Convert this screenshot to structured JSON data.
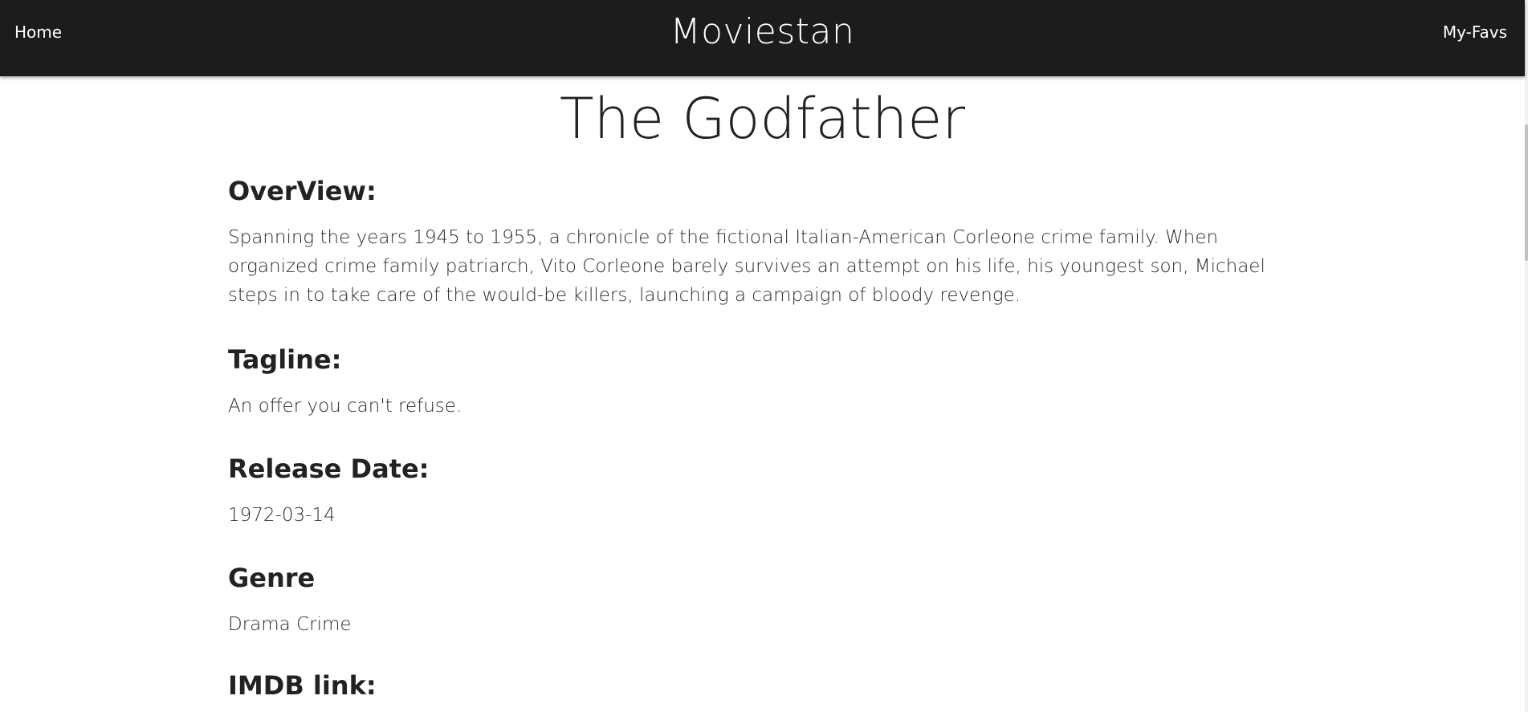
{
  "nav": {
    "home_label": "Home",
    "brand": "Moviestan",
    "favs_label": "My-Favs"
  },
  "movie": {
    "title": "The Godfather",
    "sections": {
      "overview": {
        "heading": "OverView:",
        "text": "Spanning the years 1945 to 1955, a chronicle of the fictional Italian-American Corleone crime family. When organized crime family patriarch, Vito Corleone barely survives an attempt on his life, his youngest son, Michael steps in to take care of the would-be killers, launching a campaign of bloody revenge."
      },
      "tagline": {
        "heading": "Tagline:",
        "text": "An offer you can't refuse."
      },
      "release_date": {
        "heading": "Release Date:",
        "text": "1972-03-14"
      },
      "genre": {
        "heading": "Genre",
        "text": "Drama Crime"
      },
      "imdb": {
        "heading": "IMDB link:"
      }
    }
  },
  "colors": {
    "navbar_bg": "#1c1c1c",
    "nav_text": "#ffffff",
    "body_text": "#222222"
  }
}
